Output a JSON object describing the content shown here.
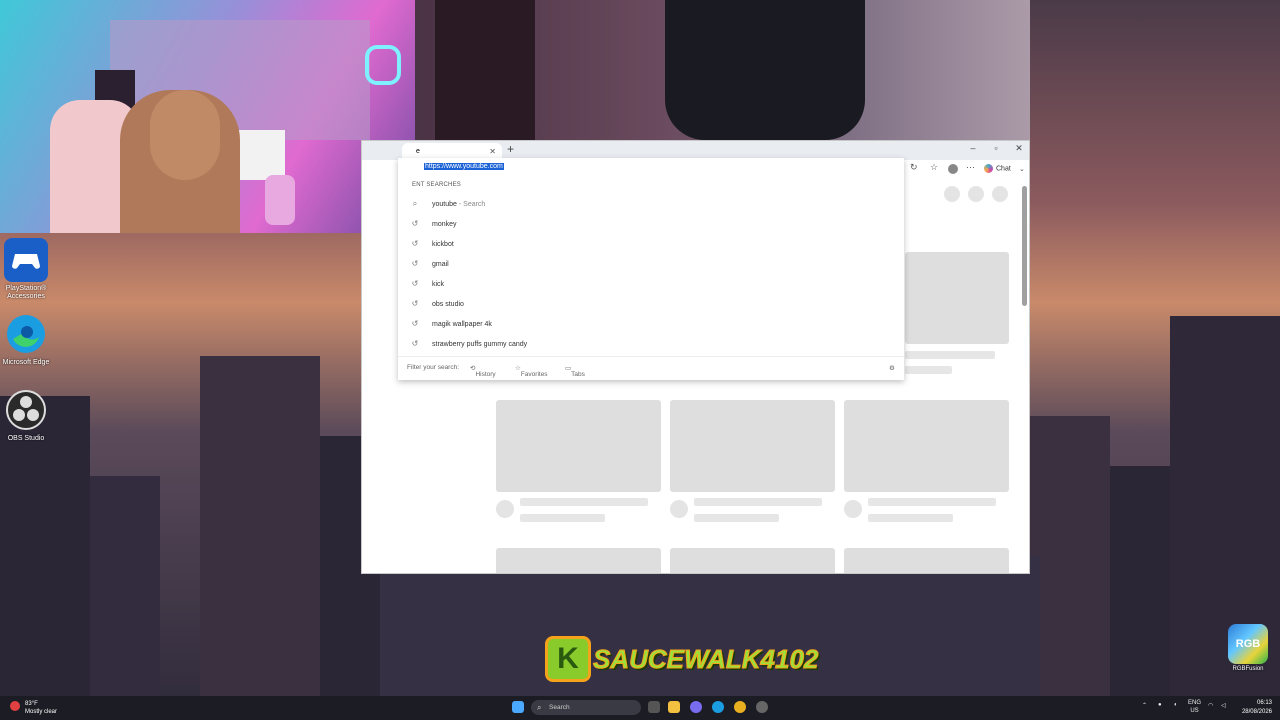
{
  "desktop": {
    "icons": [
      {
        "label": "PlayStation® Accessories",
        "icon": "playstation-accessories-icon"
      },
      {
        "label": "Microsoft Edge",
        "icon": "edge-icon"
      },
      {
        "label": "OBS Studio",
        "icon": "obs-icon"
      }
    ],
    "stream_logo": "SAUCEWALK4102",
    "rgb_fusion": {
      "badge": "RGB",
      "label": "RGBFusion"
    }
  },
  "browser": {
    "tab_title": "e",
    "chat_label": "Chat",
    "address": "https://www.youtube.com",
    "section_title": "ENT SEARCHES",
    "suggestions": [
      {
        "text": "youtube",
        "sub": "- Search",
        "icon": "search-icon"
      },
      {
        "text": "monkey",
        "sub": "",
        "icon": "history-icon"
      },
      {
        "text": "kickbot",
        "sub": "",
        "icon": "history-icon"
      },
      {
        "text": "gmail",
        "sub": "",
        "icon": "history-icon"
      },
      {
        "text": "kick",
        "sub": "",
        "icon": "history-icon"
      },
      {
        "text": "obs studio",
        "sub": "",
        "icon": "history-icon"
      },
      {
        "text": "magik wallpaper 4k",
        "sub": "",
        "icon": "history-icon"
      },
      {
        "text": "strawberry puffs gummy candy",
        "sub": "",
        "icon": "history-icon"
      }
    ],
    "footer": {
      "filter_placeholder": "Filter your search:",
      "history": "History",
      "favorites": "Favorites",
      "tabs": "Tabs"
    }
  },
  "taskbar": {
    "weather_temp": "83°F",
    "weather_desc": "Mostly clear",
    "search_placeholder": "Search",
    "lang": "ENG",
    "region": "US",
    "time": "06:13",
    "date": "28/08/2026"
  },
  "colors": {
    "selection": "#1a62d6",
    "taskbar": "#1c1c24",
    "logo_green": "#9ee03a",
    "logo_orange": "#f5a31a"
  }
}
